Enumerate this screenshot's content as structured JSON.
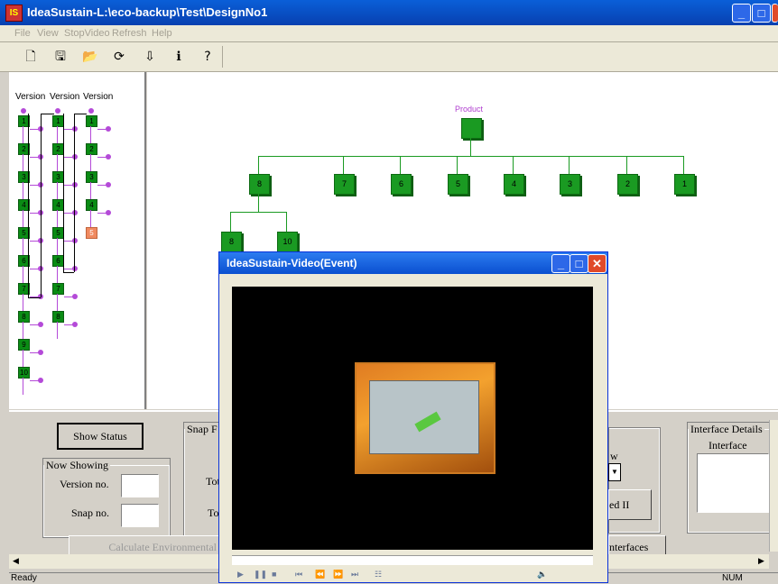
{
  "window": {
    "title": "IdeaSustain-L:\\eco-backup\\Test\\DesignNo1",
    "icon_label": "IS"
  },
  "menu": [
    "File",
    "View",
    "StopVideo",
    "Refresh",
    "Help"
  ],
  "toolbar": [
    {
      "icon": "new-document-icon",
      "glyph": "🗋"
    },
    {
      "icon": "save-icon",
      "glyph": "🖫"
    },
    {
      "icon": "open-folder-icon",
      "glyph": "📂"
    },
    {
      "icon": "refresh-icon",
      "glyph": "⟳"
    },
    {
      "icon": "import-icon",
      "glyph": "⇩"
    },
    {
      "icon": "info-icon",
      "glyph": "ℹ"
    },
    {
      "icon": "help-icon",
      "glyph": "?"
    }
  ],
  "versions": {
    "headers": [
      "Version",
      "Version",
      "Version"
    ],
    "col1": [
      "1",
      "2",
      "3",
      "4",
      "5",
      "6",
      "7",
      "8",
      "9",
      "10"
    ],
    "col2": [
      "1",
      "2",
      "3",
      "4",
      "5",
      "6",
      "7",
      "8"
    ],
    "col3": [
      "1",
      "2",
      "3",
      "4",
      "5"
    ]
  },
  "tree": {
    "root": "Product",
    "level1": [
      "8",
      "7",
      "6",
      "5",
      "4",
      "3",
      "2",
      "1"
    ],
    "level2": [
      "8",
      "10"
    ]
  },
  "panel": {
    "show_status": "Show Status",
    "now_showing": "Now Showing",
    "version_no": "Version no.",
    "snap_no": "Snap no.",
    "snap_group": "Snap F",
    "tot_1": "Tot",
    "tot_2": "To",
    "calc_button": "Calculate Environmental I",
    "w_label": "w",
    "ed_button": "ed II",
    "interfaces_button": "nterfaces",
    "interface_details": "Interface Details",
    "interface_label": "Interface"
  },
  "status": {
    "left": "Ready",
    "num": "NUM"
  },
  "video": {
    "title": "IdeaSustain-Video(Event)"
  }
}
